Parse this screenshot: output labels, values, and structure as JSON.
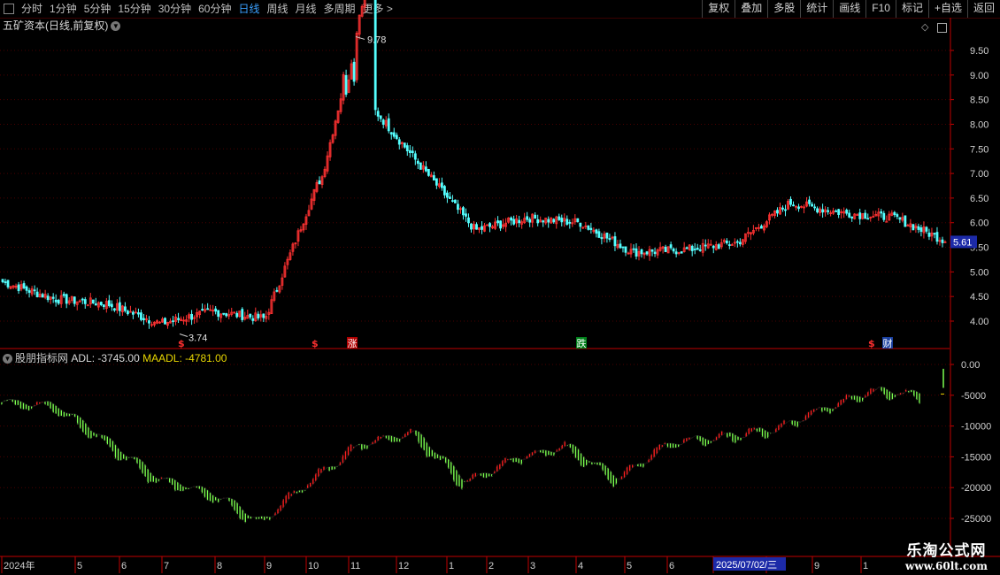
{
  "toolbar": {
    "periods": [
      "分时",
      "1分钟",
      "5分钟",
      "15分钟",
      "30分钟",
      "60分钟",
      "日线",
      "周线",
      "月线",
      "多周期",
      "更多 >"
    ],
    "active": "日线",
    "right_buttons": [
      "复权",
      "叠加",
      "多股",
      "统计",
      "画线",
      "F10",
      "标记",
      "+自选",
      "返回"
    ]
  },
  "stock": {
    "title": "五矿资本(日线,前复权)",
    "high_label": "9.78",
    "low_label": "3.74",
    "current_price": "5.61",
    "price_axis": [
      "9.50",
      "9.00",
      "8.50",
      "8.00",
      "7.50",
      "7.00",
      "6.50",
      "6.00",
      "5.50",
      "5.00",
      "4.50",
      "4.00"
    ],
    "markers": [
      {
        "text": "$",
        "color": "#ff3030",
        "kind": "s"
      },
      {
        "text": "$",
        "color": "#ff3030",
        "kind": "s"
      },
      {
        "text": "涨",
        "color": "#ffffff",
        "bg": "#b00000",
        "kind": "box"
      },
      {
        "text": "跌",
        "color": "#ffffff",
        "bg": "#00801a",
        "kind": "box"
      },
      {
        "text": "$",
        "color": "#ff3030",
        "kind": "s"
      },
      {
        "text": "财",
        "color": "#ffffff",
        "bg": "#1a40a0",
        "kind": "box"
      }
    ]
  },
  "indicator": {
    "name": "股朋指标网",
    "adl_label": "ADL: -3745.00",
    "maadl_label": "MAADL: -4781.00",
    "axis": [
      "0.00",
      "-5000",
      "-10000",
      "-15000",
      "-20000",
      "-25000"
    ]
  },
  "time_axis": {
    "labels": [
      "2024年",
      "5",
      "6",
      "7",
      "8",
      "9",
      "10",
      "11",
      "12",
      "1",
      "2",
      "3",
      "4",
      "5",
      "6",
      "7",
      "8",
      "9",
      "1"
    ],
    "cursor_date": "2025/07/02/三"
  },
  "colors": {
    "up": "#ff3232",
    "down": "#54ffff",
    "adl_up": "#ff2020",
    "adl_down": "#7cff50",
    "grid": "#4a0000",
    "axis": "#c00000"
  },
  "watermark": {
    "line1": "乐淘公式网",
    "line2": "www.60lt.com"
  },
  "chart_data": [
    {
      "type": "candlestick",
      "title": "五矿资本(日线,前复权)",
      "ylim": [
        3.6,
        10.0
      ],
      "x_months": [
        "2024-04",
        "2024-05",
        "2024-06",
        "2024-07",
        "2024-08",
        "2024-09",
        "2024-10",
        "2024-11",
        "2024-12",
        "2025-01",
        "2025-02",
        "2025-03",
        "2025-04",
        "2025-05",
        "2025-06",
        "2025-07",
        "2025-08",
        "2025-09",
        "2025-10"
      ],
      "close_by_month": [
        4.8,
        4.45,
        4.35,
        3.95,
        4.2,
        4.05,
        6.8,
        8.4,
        7.1,
        5.85,
        6.1,
        6.0,
        5.4,
        5.45,
        5.6,
        6.4,
        6.2,
        6.1,
        5.61
      ],
      "annotations": {
        "max": 9.78,
        "min": 3.74,
        "last": 5.61
      }
    },
    {
      "type": "line",
      "series": [
        {
          "name": "ADL"
        },
        {
          "name": "MAADL"
        }
      ],
      "ylim": [
        -27000,
        1000
      ],
      "x_months": [
        "2024-04",
        "2024-05",
        "2024-06",
        "2024-07",
        "2024-08",
        "2024-09",
        "2024-10",
        "2024-11",
        "2024-12",
        "2025-01",
        "2025-02",
        "2025-03",
        "2025-04",
        "2025-05",
        "2025-06",
        "2025-07",
        "2025-08",
        "2025-09",
        "2025-10"
      ],
      "adl_by_month": [
        -6500,
        -7000,
        -13000,
        -19000,
        -21000,
        -26000,
        -19000,
        -13000,
        -11500,
        -19500,
        -15500,
        -13500,
        -19000,
        -13000,
        -12000,
        -11000,
        -7500,
        -4500,
        -5500
      ],
      "last": {
        "ADL": -3745.0,
        "MAADL": -4781.0
      }
    }
  ]
}
